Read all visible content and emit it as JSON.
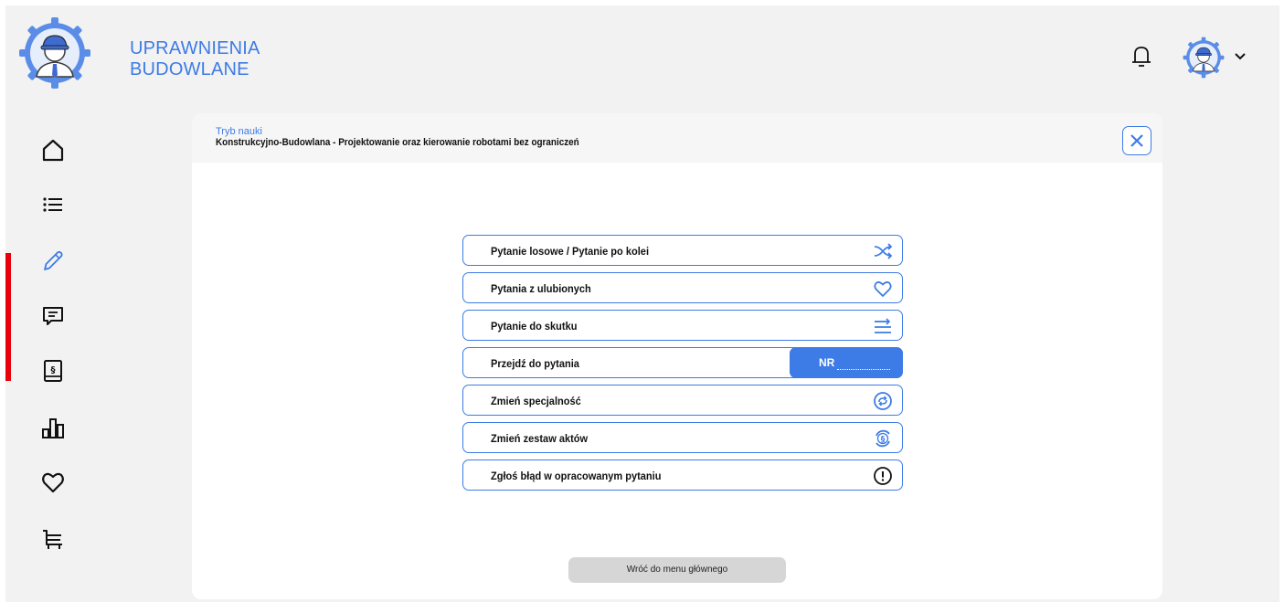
{
  "brand": {
    "line1": "UPRAWNIENIA",
    "line2": "BUDOWLANE"
  },
  "header": {
    "mode_label": "Tryb nauki",
    "mode_title": "Konstrukcyjno-Budowlana - Projektowanie oraz kierowanie robotami bez ograniczeń"
  },
  "sidebar": {
    "items": [
      {
        "icon": "home-icon"
      },
      {
        "icon": "list-icon"
      },
      {
        "icon": "pencil-icon",
        "active": true
      },
      {
        "icon": "chat-icon"
      },
      {
        "icon": "law-book-icon"
      },
      {
        "icon": "stats-icon"
      },
      {
        "icon": "heart-icon"
      },
      {
        "icon": "cart-icon"
      }
    ]
  },
  "options": {
    "random": "Pytanie losowe / Pytanie po kolei",
    "favourites": "Pytania z ulubionych",
    "until_success": "Pytanie do skutku",
    "goto": "Przejdź do pytania",
    "goto_nr": "NR",
    "change_specialty": "Zmień specjalność",
    "change_acts": "Zmień zestaw aktów",
    "report_error": "Zgłoś błąd w opracowanym pytaniu"
  },
  "back_button": "Wróć do menu głównego",
  "colors": {
    "accent": "#3d7be6",
    "active_marker": "#e8000b",
    "background": "#f2f2f2"
  }
}
